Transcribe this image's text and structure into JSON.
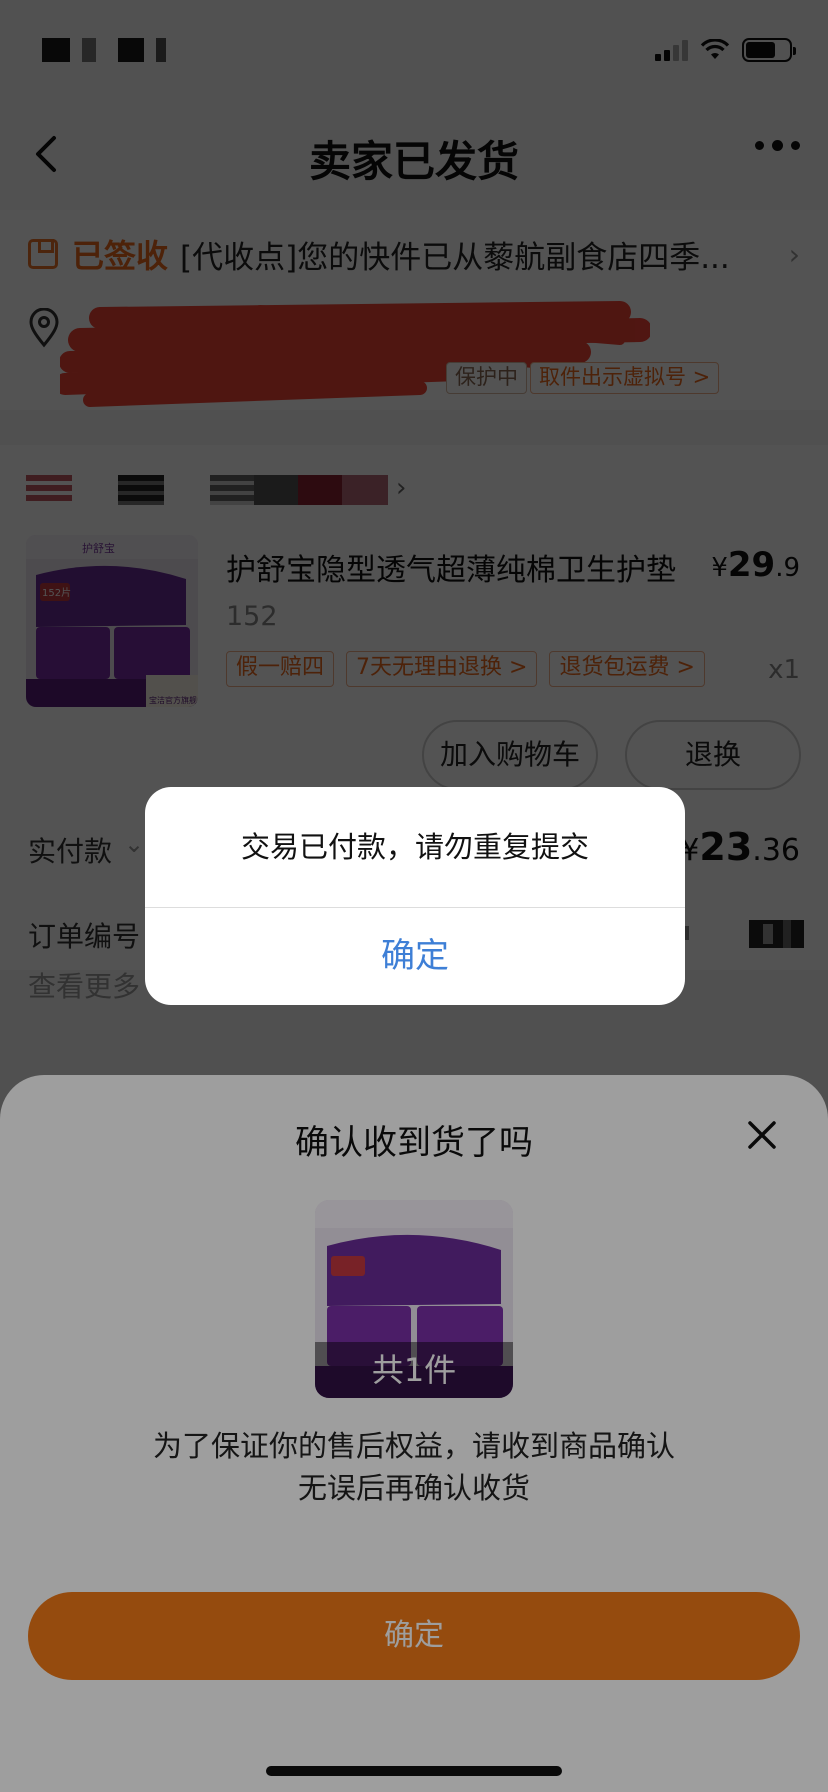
{
  "nav": {
    "title": "卖家已发货"
  },
  "logistics": {
    "status": "已签收",
    "text": "[代收点]您的快件已从藜航副食店四季...",
    "tags": [
      "保护中",
      "取件出示虚拟号 >"
    ]
  },
  "product": {
    "title": "护舒宝隐型透气超薄纯棉卫生护垫",
    "price_symbol": "¥",
    "price_int": "29",
    "price_dec": ".9",
    "spec": "152",
    "tags": [
      "假一赔四",
      "7天无理由退换 >",
      "退货包运费 >"
    ],
    "qty": "x1",
    "image_brand": "护舒宝",
    "image_store": "宝洁官方旗舰店",
    "image_count_badge": "152片"
  },
  "actions": {
    "add_cart": "加入购物车",
    "return": "退换"
  },
  "payment": {
    "label": "实付款",
    "amount_symbol": "¥",
    "amount_int": "23",
    "amount_dec": ".36"
  },
  "order": {
    "number_label": "订单编号",
    "more_label": "查看更多"
  },
  "sheet": {
    "title": "确认收到货了吗",
    "count": "共1件",
    "desc_line1": "为了保证你的售后权益，请收到商品确认",
    "desc_line2": "无误后再确认收货",
    "confirm": "确定"
  },
  "alert": {
    "message": "交易已付款，请勿重复提交",
    "ok": "确定"
  },
  "colors": {
    "accent": "#ec6a1f",
    "confirm_bg": "#f07a18",
    "alert_link": "#3e7fd6"
  }
}
